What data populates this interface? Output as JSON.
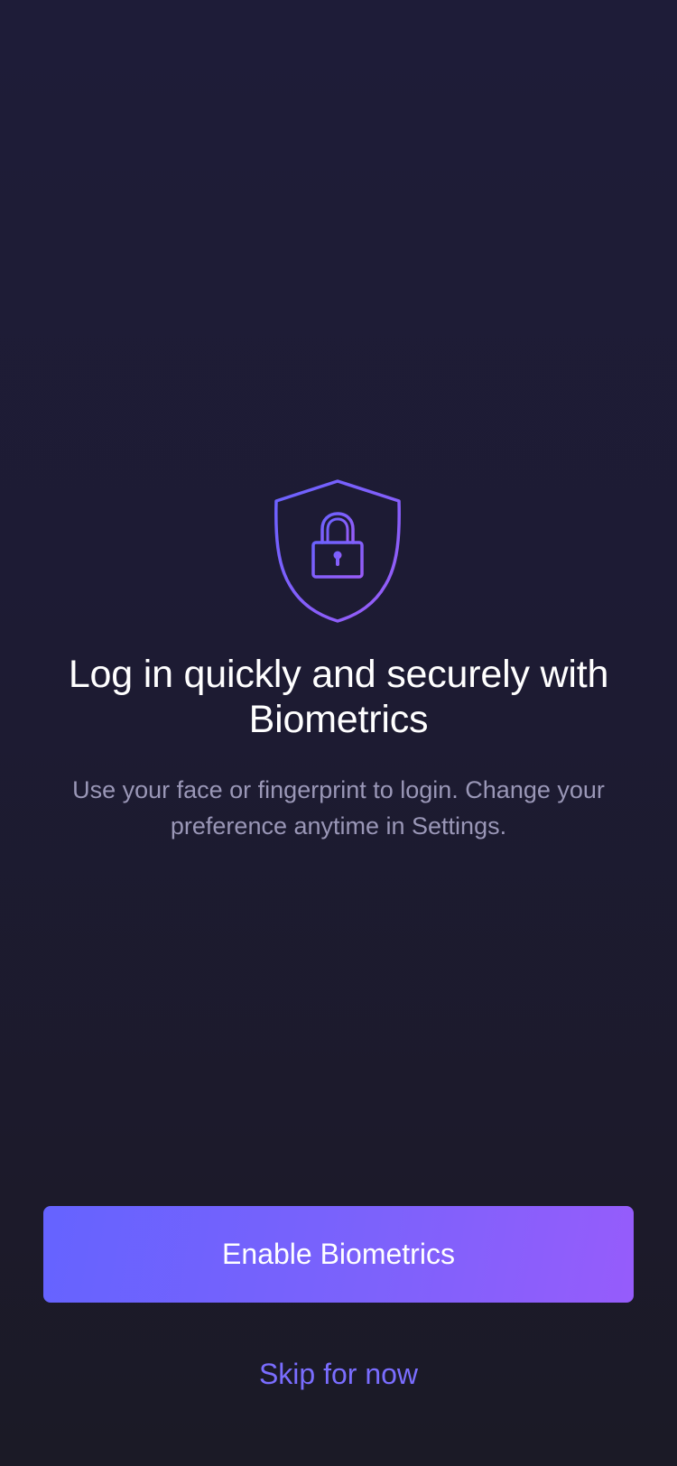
{
  "hero": {
    "icon": "shield-lock-icon",
    "accent_start": "#6a62ff",
    "accent_end": "#9a5cf7"
  },
  "content": {
    "title": "Log in quickly and securely with Biometrics",
    "subtitle": "Use your face or fingerprint to login. Change your preference anytime in Settings."
  },
  "actions": {
    "primary_label": "Enable Biometrics",
    "secondary_label": "Skip for now",
    "primary_gradient_start": "#6563ff",
    "primary_gradient_end": "#965cfb",
    "secondary_color": "#7a6dff"
  },
  "colors": {
    "background_top": "#1e1c38",
    "background_bottom": "#1b1a26",
    "subtitle_text": "#9a97b7"
  }
}
